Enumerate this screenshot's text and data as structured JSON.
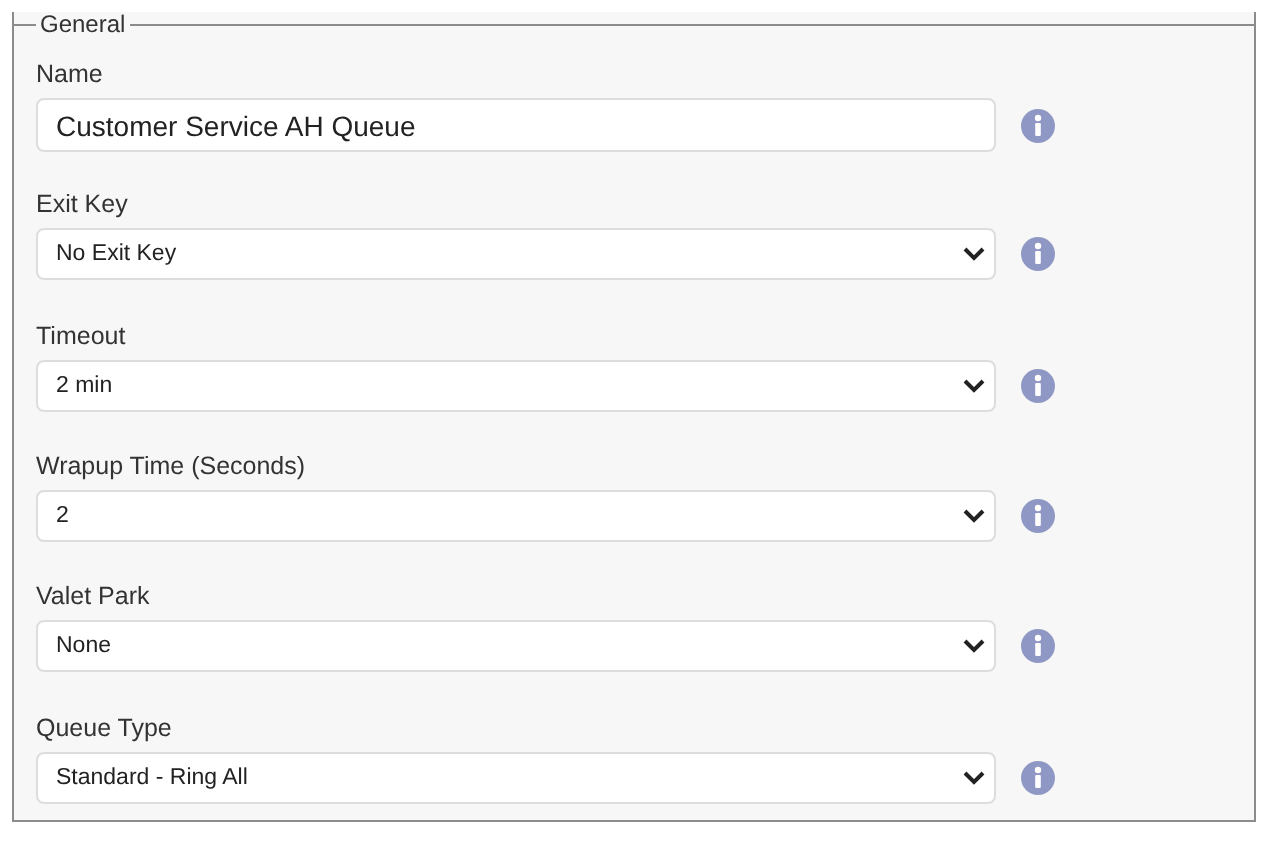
{
  "fieldset": {
    "legend": "General"
  },
  "fields": [
    {
      "kind": "text",
      "label": "Name",
      "value": "Customer Service AH Queue"
    },
    {
      "kind": "select",
      "label": "Exit Key",
      "value": "No Exit Key"
    },
    {
      "kind": "select",
      "label": "Timeout",
      "value": "2 min"
    },
    {
      "kind": "select",
      "label": "Wrapup Time (Seconds)",
      "value": "2"
    },
    {
      "kind": "select",
      "label": "Valet Park",
      "value": "None"
    },
    {
      "kind": "select",
      "label": "Queue Type",
      "value": "Standard - Ring All"
    }
  ]
}
